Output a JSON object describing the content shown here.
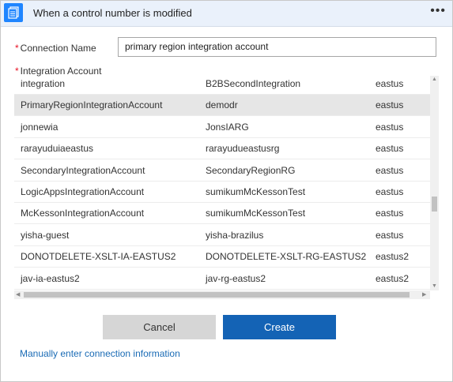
{
  "header": {
    "title": "When a control number is modified",
    "more_label": "•••",
    "icon": "integration-account-icon",
    "icon_color": "#1f85ff"
  },
  "form": {
    "required_marker": "*",
    "connection_name_label": "Connection Name",
    "connection_name_value": "primary region integration account",
    "integration_account_label": "Integration Account"
  },
  "accounts": [
    {
      "name": "integration",
      "resource_group": "B2BSecondIntegration",
      "location": "eastus",
      "selected": false
    },
    {
      "name": "PrimaryRegionIntegrationAccount",
      "resource_group": "demodr",
      "location": "eastus",
      "selected": true
    },
    {
      "name": "jonnewia",
      "resource_group": "JonsIARG",
      "location": "eastus",
      "selected": false
    },
    {
      "name": "rarayuduiaeastus",
      "resource_group": "rarayudueastusrg",
      "location": "eastus",
      "selected": false
    },
    {
      "name": "SecondaryIntegrationAccount",
      "resource_group": "SecondaryRegionRG",
      "location": "eastus",
      "selected": false
    },
    {
      "name": "LogicAppsIntegrationAccount",
      "resource_group": "sumikumMcKessonTest",
      "location": "eastus",
      "selected": false
    },
    {
      "name": "McKessonIntegrationAccount",
      "resource_group": "sumikumMcKessonTest",
      "location": "eastus",
      "selected": false
    },
    {
      "name": "yisha-guest",
      "resource_group": "yisha-brazilus",
      "location": "eastus",
      "selected": false
    },
    {
      "name": "DONOTDELETE-XSLT-IA-EASTUS2",
      "resource_group": "DONOTDELETE-XSLT-RG-EASTUS2",
      "location": "eastus2",
      "selected": false
    },
    {
      "name": "jav-ia-eastus2",
      "resource_group": "jav-rg-eastus2",
      "location": "eastus2",
      "selected": false
    }
  ],
  "buttons": {
    "cancel": "Cancel",
    "create": "Create",
    "create_color": "#1463b5"
  },
  "manual_link": "Manually enter connection information"
}
